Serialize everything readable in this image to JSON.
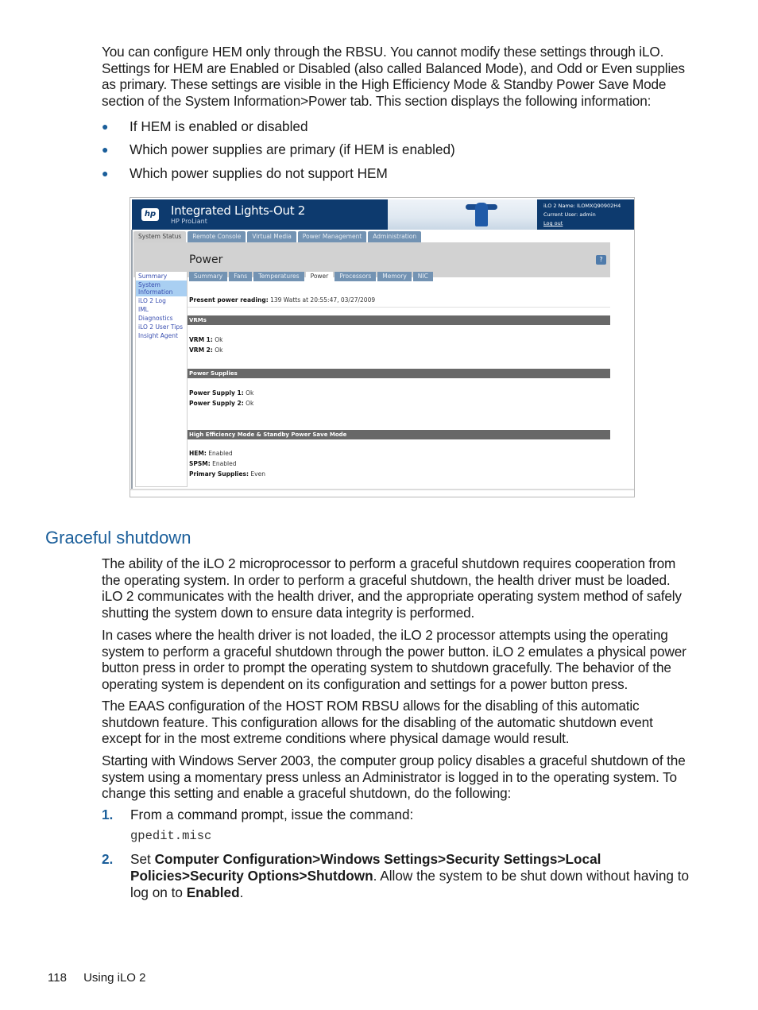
{
  "intro": {
    "paragraph": "You can configure HEM only through the RBSU. You cannot modify these settings through iLO. Settings for HEM are Enabled or Disabled (also called Balanced Mode), and Odd or Even supplies as primary. These settings are visible in the High Efficiency Mode & Standby Power Save Mode section of the System Information>Power tab. This section displays the following information:",
    "bullets": [
      "If HEM is enabled or disabled",
      "Which power supplies are primary (if HEM is enabled)",
      "Which power supplies do not support HEM"
    ]
  },
  "screenshot": {
    "logo_text": "hp",
    "product_title": "Integrated Lights-Out 2",
    "product_subtitle": "HP ProLiant",
    "ilo_name": "iLO 2 Name:  ILOMXQ90902H4",
    "current_user": "Current User:  admin",
    "logout": "Log out",
    "main_tabs": [
      "System Status",
      "Remote Console",
      "Virtual Media",
      "Power Management",
      "Administration"
    ],
    "active_main_tab": "System Status",
    "page_title": "Power",
    "help_icon": "?",
    "sub_tabs": [
      "Summary",
      "Fans",
      "Temperatures",
      "Power",
      "Processors",
      "Memory",
      "NIC"
    ],
    "active_sub_tab": "Power",
    "sidebar": [
      "Summary",
      "System Information",
      "iLO 2 Log",
      "IML",
      "Diagnostics",
      "iLO 2 User Tips",
      "Insight Agent"
    ],
    "active_sidebar": "System Information",
    "power_reading_label": "Present power reading:",
    "power_reading_value": "139 Watts at 20:55:47, 03/27/2009",
    "sections": [
      {
        "title": "VRMs",
        "rows": [
          {
            "label": "VRM 1:",
            "value": "Ok"
          },
          {
            "label": "VRM 2:",
            "value": "Ok"
          }
        ]
      },
      {
        "title": "Power Supplies",
        "rows": [
          {
            "label": "Power Supply 1:",
            "value": "Ok"
          },
          {
            "label": "Power Supply 2:",
            "value": "Ok"
          }
        ]
      },
      {
        "title": "High Efficiency Mode & Standby Power Save Mode",
        "rows": [
          {
            "label": "HEM:",
            "value": "Enabled"
          },
          {
            "label": "SPSM:",
            "value": "Enabled"
          },
          {
            "label": "Primary Supplies:",
            "value": "Even"
          }
        ]
      }
    ]
  },
  "section": {
    "heading": "Graceful shutdown",
    "paragraphs": [
      "The ability of the iLO 2 microprocessor to perform a graceful shutdown requires cooperation from the operating system. In order to perform a graceful shutdown, the health driver must be loaded. iLO 2 communicates with the health driver, and the appropriate operating system method of safely shutting the system down to ensure data integrity is performed.",
      "In cases where the health driver is not loaded, the iLO 2 processor attempts using the operating system to perform a graceful shutdown through the power button. iLO 2 emulates a physical power button press in order to prompt the operating system to shutdown gracefully. The behavior of the operating system is dependent on its configuration and settings for a power button press.",
      "The EAAS configuration of the HOST ROM RBSU allows for the disabling of this automatic shutdown feature. This configuration allows for the disabling of the automatic shutdown event except for in the most extreme conditions where physical damage would result.",
      "Starting with Windows Server 2003, the computer group policy disables a graceful shutdown of the system using a momentary press unless an Administrator is logged in to the operating system. To change this setting and enable a graceful shutdown, do the following:"
    ],
    "steps": [
      {
        "number": "1.",
        "text": "From a command prompt, issue the command:",
        "code": "gpedit.misc"
      },
      {
        "number": "2.",
        "prefix": "Set ",
        "bold_path": "Computer Configuration>Windows Settings>Security Settings>Local Policies>Security Options>Shutdown",
        "middle": ". Allow the system to be shut down without having to log on to ",
        "bold_end": "Enabled",
        "suffix": "."
      }
    ]
  },
  "footer": {
    "page_number": "118",
    "chapter": "Using iLO 2"
  }
}
